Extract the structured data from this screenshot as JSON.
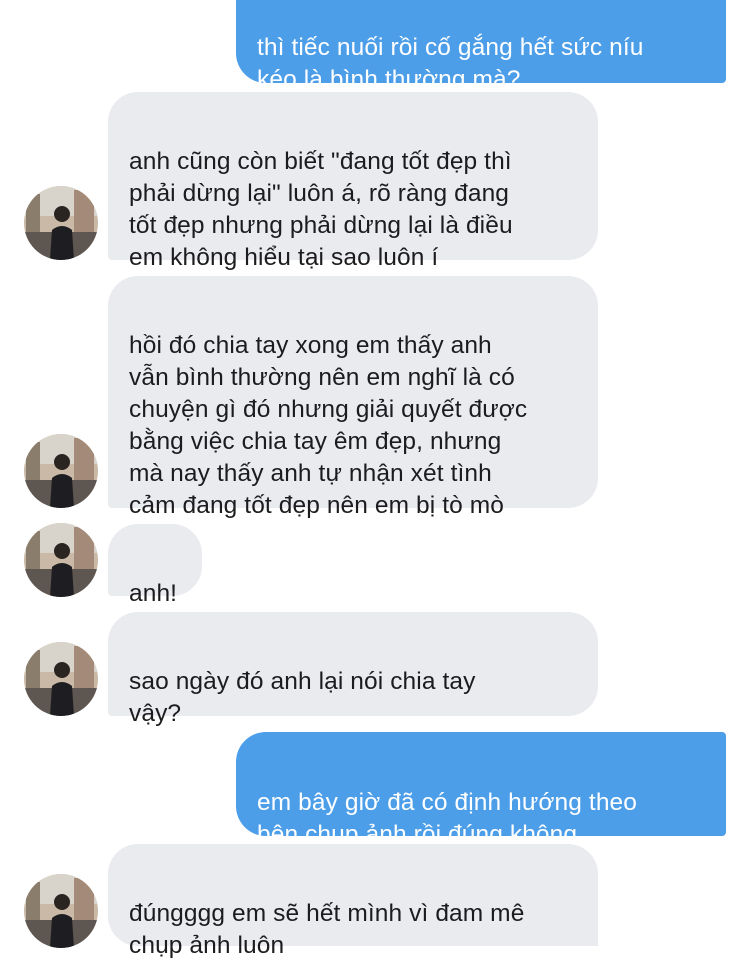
{
  "conversation": {
    "messages": [
      {
        "id": "m1",
        "sender": "me",
        "text": "thì tiếc nuối rồi cố gắng hết sức níu\nkéo là bình thường mà?"
      },
      {
        "id": "m2",
        "sender": "them",
        "text": "anh cũng còn biết \"đang tốt đẹp thì\nphải dừng lại\" luôn á, rõ ràng đang\ntốt đẹp nhưng phải dừng lại là điều\nem không hiểu tại sao luôn í"
      },
      {
        "id": "m3",
        "sender": "them",
        "text": "hồi đó chia tay xong em thấy anh\nvẫn bình thường nên em nghĩ là có\nchuyện gì đó nhưng giải quyết được\nbằng việc chia tay êm đẹp, nhưng\nmà nay thấy anh tự nhận xét tình\ncảm đang tốt đẹp nên em bị tò mò"
      },
      {
        "id": "m4",
        "sender": "them",
        "text": "anh!"
      },
      {
        "id": "m5",
        "sender": "them",
        "text": "sao ngày đó anh lại nói chia tay\nvậy?"
      },
      {
        "id": "m6",
        "sender": "me",
        "text": "em bây giờ đã có định hướng theo\nbên chụp ảnh rồi đúng không"
      },
      {
        "id": "m7",
        "sender": "them",
        "text": "đúngggg em sẽ hết mình vì đam mê\nchụp ảnh luôn"
      }
    ]
  },
  "theme": {
    "outgoing_bubble": "#4d9ee9",
    "incoming_bubble": "#e9ebef",
    "incoming_text": "#1c1c1e",
    "outgoing_text": "#ffffff"
  },
  "avatar": {
    "icon": "contact-avatar-photo"
  }
}
